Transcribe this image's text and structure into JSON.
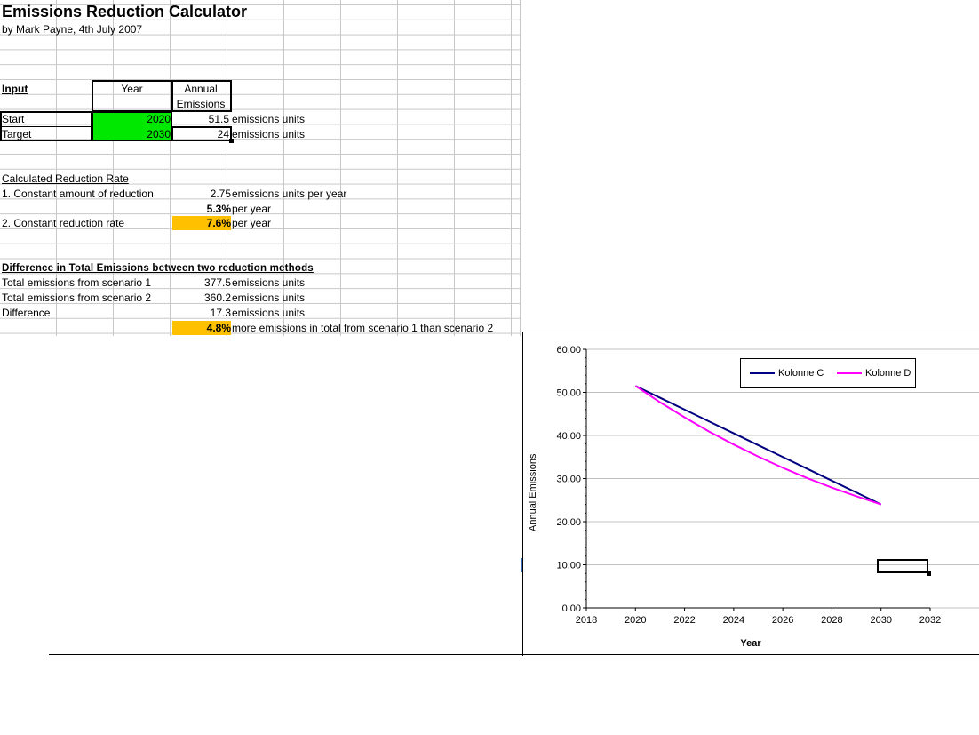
{
  "sheet": {
    "title": "Emissions Reduction Calculator",
    "author_line": "by Mark Payne, 4th July 2007",
    "input": {
      "heading": "Input",
      "col_year": "Year",
      "col_emissions_line1": "Annual",
      "col_emissions_line2": "Emissions",
      "start_label": "Start",
      "target_label": "Target",
      "start_year": "2020",
      "target_year": "2030",
      "start_emissions": "51.5",
      "target_emissions": "24",
      "unit": "emissions units"
    },
    "calc": {
      "heading": "Calculated Reduction Rate",
      "method1_label": "1. Constant amount of reduction",
      "method1_value": "2.75",
      "method1_unit": "emissions units per year",
      "pct_value": "5.3%",
      "pct_unit": "per year",
      "method2_label": "2. Constant reduction rate",
      "method2_value": "7.6%",
      "method2_unit": "per year"
    },
    "diff": {
      "heading": "Difference in Total Emissions between two reduction methods",
      "s1_label": "Total emissions from scenario 1",
      "s1_value": "377.5",
      "s2_label": "Total emissions from scenario 2",
      "s2_value": "360.2",
      "diff_label": "Difference",
      "diff_value": "17.3",
      "unit": "emissions units",
      "pct_value": "4.8%",
      "pct_text": "more emissions in total from scenario 1 than scenario 2"
    }
  },
  "chart_data": {
    "type": "line",
    "title": "",
    "xlabel": "Year",
    "ylabel": "Annual Emissions",
    "xlim": [
      2018,
      2032
    ],
    "ylim": [
      0,
      60
    ],
    "x_ticks": [
      "2018",
      "2020",
      "2022",
      "2024",
      "2026",
      "2028",
      "2030",
      "2032"
    ],
    "y_ticks": [
      "0.00",
      "10.00",
      "20.00",
      "30.00",
      "40.00",
      "50.00",
      "60.00"
    ],
    "grid": true,
    "legend_position": "top-right",
    "series": [
      {
        "name": "Kolonne C",
        "color": "#000080",
        "x": [
          2020,
          2021,
          2022,
          2023,
          2024,
          2025,
          2026,
          2027,
          2028,
          2029,
          2030
        ],
        "y": [
          51.5,
          48.75,
          46.0,
          43.25,
          40.5,
          37.75,
          35.0,
          32.25,
          29.5,
          26.75,
          24.0
        ]
      },
      {
        "name": "Kolonne D",
        "color": "#ff00ff",
        "x": [
          2020,
          2021,
          2022,
          2023,
          2024,
          2025,
          2026,
          2027,
          2028,
          2029,
          2030
        ],
        "y": [
          51.5,
          47.7,
          44.2,
          40.9,
          37.9,
          35.1,
          32.5,
          30.1,
          27.9,
          25.9,
          24.0
        ]
      }
    ]
  }
}
